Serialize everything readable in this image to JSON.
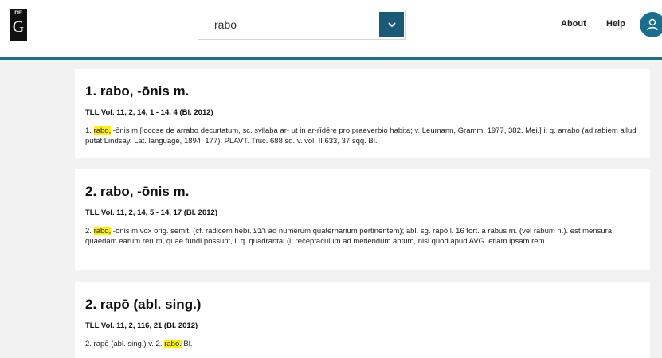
{
  "header": {
    "logo": {
      "top": "DE",
      "bottom": "G"
    },
    "search": {
      "value": "rabo",
      "placeholder": ""
    },
    "nav": {
      "about": "About",
      "help": "Help"
    },
    "icons": {
      "search_button": "chevron-down-icon",
      "avatar": "user-icon"
    },
    "colors": {
      "accent": "#1a6f8e",
      "button": "#1a5a78",
      "highlight": "#fff200"
    }
  },
  "results": [
    {
      "title": "1. rabo, -ōnis m.",
      "ref": "TLL Vol. 11, 2, 14, 1 - 14, 4 (Bl. 2012)",
      "body_pre": "1. ",
      "body_hl": "rabo,",
      "body_post": " -ōnis m.[iocose de arrabo decurtatum, sc. syllaba ar- ut in ar-rīdēre pro praeverbio habita; v. Leumann, Gramm. 1977, 382. Mei.] i. q. arrabo (ad rabiem alludi putat Lindsay, Lat. language, 1894, 177): PLAVT. Truc. 688 sq. v. vol. II 633, 37 sqq. Bl."
    },
    {
      "title": "2. rabo, -ōnis m.",
      "ref": "TLL Vol. 11, 2, 14, 5 - 14, 17 (Bl. 2012)",
      "body_pre": "2. ",
      "body_hl": "rabo,",
      "body_post": " -ōnis m.vox orig. semit. (cf. radicem hebr. רבע ad numerum quaternarium pertinentem); abl. sg. rapō l. 16 fort. a rabus m. (vel rabum n.). est mensura quaedam earum rerum, quae fundi possunt, i. q. quadrantal (i. receptaculum ad metiendum aptum, nisi quod apud AVG. etiam ipsam rem"
    },
    {
      "title": "2. rapō (abl. sing.)",
      "ref": "TLL Vol. 11, 2, 116, 21 (Bl. 2012)",
      "body_pre": "2. rapō (abl. sing.) v. 2. ",
      "body_hl": "rabo.",
      "body_post": " Bl."
    }
  ]
}
